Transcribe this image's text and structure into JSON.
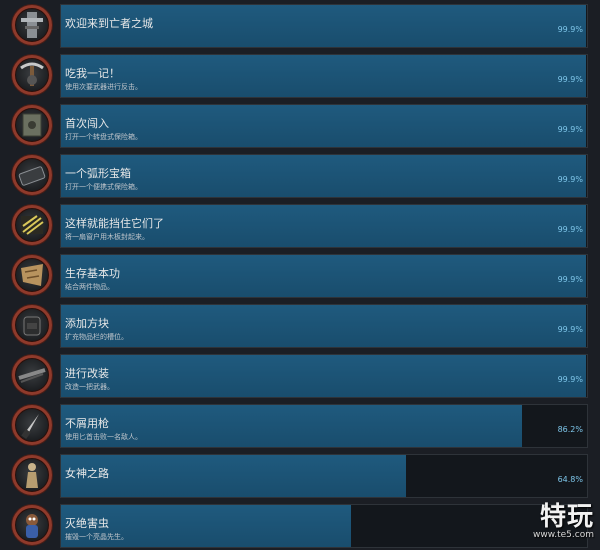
{
  "achievements": [
    {
      "title": "欢迎来到亡者之城",
      "desc": "",
      "percent": "99.9%",
      "fill": 0.999,
      "icon": "tower-icon"
    },
    {
      "title": "吃我一记！",
      "desc": "使用次要武器进行反击。",
      "percent": "99.9%",
      "fill": 0.999,
      "icon": "crossbow-icon"
    },
    {
      "title": "首次闯入",
      "desc": "打开一个转盘式保险箱。",
      "percent": "99.9%",
      "fill": 0.999,
      "icon": "safe-icon"
    },
    {
      "title": "一个弧形宝箱",
      "desc": "打开一个便携式保险箱。",
      "percent": "99.9%",
      "fill": 0.999,
      "icon": "portable-safe-icon"
    },
    {
      "title": "这样就能挡住它们了",
      "desc": "将一扇窗户用木板封起来。",
      "percent": "99.9%",
      "fill": 0.999,
      "icon": "planks-icon"
    },
    {
      "title": "生存基本功",
      "desc": "结合两件物品。",
      "percent": "99.9%",
      "fill": 0.999,
      "icon": "map-icon"
    },
    {
      "title": "添加方块",
      "desc": "扩充物品栏的槽位。",
      "percent": "99.9%",
      "fill": 0.999,
      "icon": "backpack-icon"
    },
    {
      "title": "进行改装",
      "desc": "改造一把武器。",
      "percent": "99.9%",
      "fill": 0.999,
      "icon": "rifle-icon"
    },
    {
      "title": "不屑用枪",
      "desc": "使用匕首击败一名敌人。",
      "percent": "86.2%",
      "fill": 0.877,
      "icon": "knife-icon"
    },
    {
      "title": "女神之路",
      "desc": "",
      "percent": "64.8%",
      "fill": 0.655,
      "icon": "statue-icon"
    },
    {
      "title": "灭绝害虫",
      "desc": "摧毁一个亮晶先生。",
      "percent": "",
      "fill": 0.551,
      "icon": "mr-raccoon-icon"
    }
  ],
  "watermark": {
    "main": "特玩",
    "sub": "www.te5.com"
  },
  "colors": {
    "fill": "#1f5a7e",
    "track": "#13171c",
    "percent_text": "#7ec6ea",
    "ring": "#8f3a2b"
  }
}
